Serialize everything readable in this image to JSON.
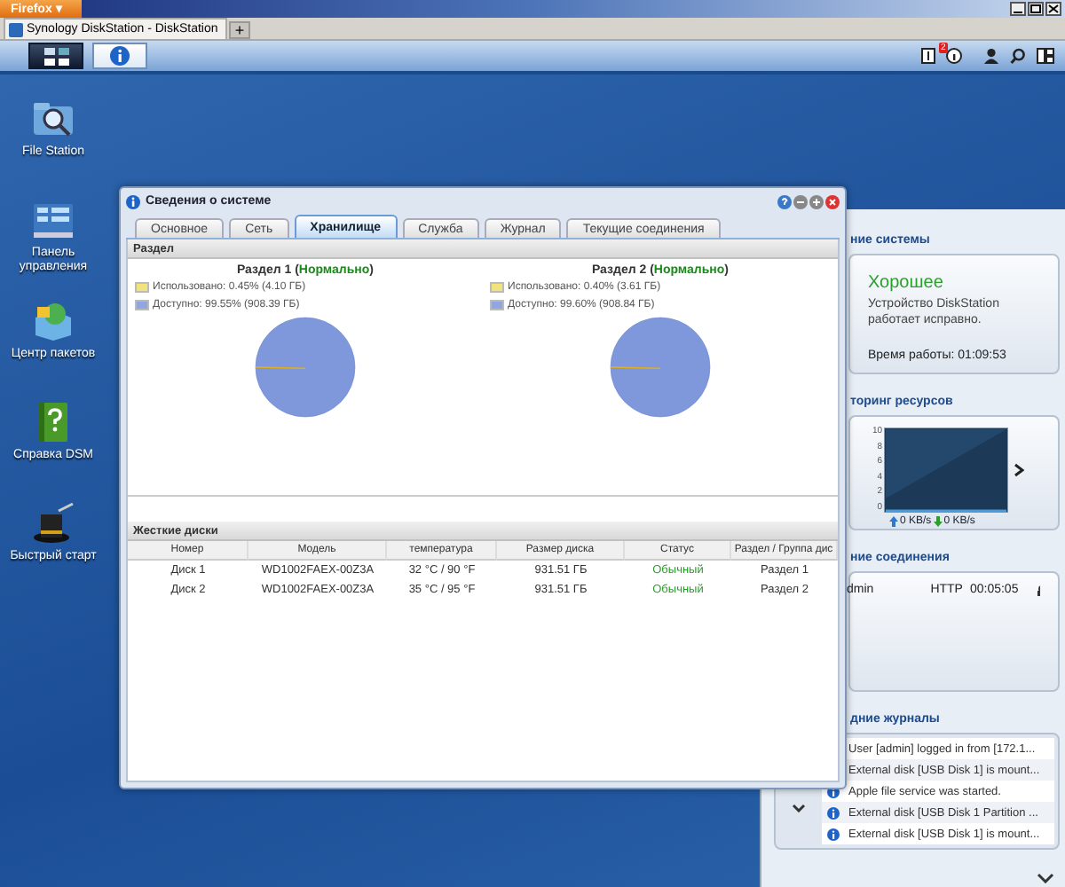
{
  "browser": {
    "menu_button": "Firefox ▾",
    "tab": "Synology DiskStation - DiskStation",
    "new_tab": "+"
  },
  "taskbar": {
    "badge": "2"
  },
  "desktop_icons": [
    {
      "label": "File Station",
      "kind": "files"
    },
    {
      "label": "Панель управления",
      "kind": "panel"
    },
    {
      "label": "Центр пакетов",
      "kind": "packages"
    },
    {
      "label": "Справка DSM",
      "kind": "help"
    },
    {
      "label": "Быстрый старт",
      "kind": "wizard"
    }
  ],
  "window": {
    "title": "Сведения о системе",
    "tabs": [
      {
        "label": "Основное",
        "selected": false
      },
      {
        "label": "Сеть",
        "selected": false
      },
      {
        "label": "Хранилище",
        "selected": true
      },
      {
        "label": "Служба",
        "selected": false
      },
      {
        "label": "Журнал",
        "selected": false
      },
      {
        "label": "Текущие соединения",
        "selected": false
      }
    ],
    "partition_section": "Раздел",
    "partitions": [
      {
        "title": "Раздел 1 (**Нормально**)",
        "legend": [
          {
            "text": "Использовано: 0.45% (4.10 ГБ)",
            "color": "#f3e27a"
          },
          {
            "text": "Доступно: 99.55% (908.39 ГБ)",
            "color": "#8fa6e0"
          }
        ]
      },
      {
        "title": "Раздел 2 (**Нормально**)",
        "legend": [
          {
            "text": "Использовано: 0.40% (3.61 ГБ)",
            "color": "#f3e27a"
          },
          {
            "text": "Доступно: 99.60% (908.84 ГБ)",
            "color": "#8fa6e0"
          }
        ]
      }
    ],
    "disks_section": "Жесткие диски",
    "disk_columns": [
      "Номер",
      "Модель",
      "температура",
      "Размер диска",
      "Статус",
      "Раздел / Группа дис"
    ],
    "disks": [
      [
        "Диск 1",
        "WD1002FAEX-00Z3A",
        "32 °C / 90 °F",
        "931.51 ГБ",
        "Обычный",
        "Раздел 1"
      ],
      [
        "Диск 2",
        "WD1002FAEX-00Z3A",
        "35 °C / 95 °F",
        "931.51 ГБ",
        "Обычный",
        "Раздел 2"
      ]
    ]
  },
  "widgets": {
    "health_heading": "ние системы",
    "health_status": "Хорошее",
    "health_text": "Устройство DiskStation работает исправно.",
    "uptime": "Время работы: 01:09:53",
    "monitor_heading": "торинг ресурсов",
    "monitor_ticks": [
      "10",
      "8",
      "6",
      "4",
      "2",
      "0"
    ],
    "upload": "0 KB/s",
    "download": "0 KB/s",
    "connections_heading": "ние соединения",
    "connection": {
      "user": "dmin",
      "protocol": "HTTP",
      "time": "00:05:05"
    },
    "logs_heading": "дние журналы",
    "logs": [
      "User [admin] logged in from [172.1...",
      "External disk [USB Disk 1] is mount...",
      "Apple file service was started.",
      "External disk [USB Disk 1 Partition ...",
      "External disk [USB Disk 1] is mount..."
    ]
  }
}
